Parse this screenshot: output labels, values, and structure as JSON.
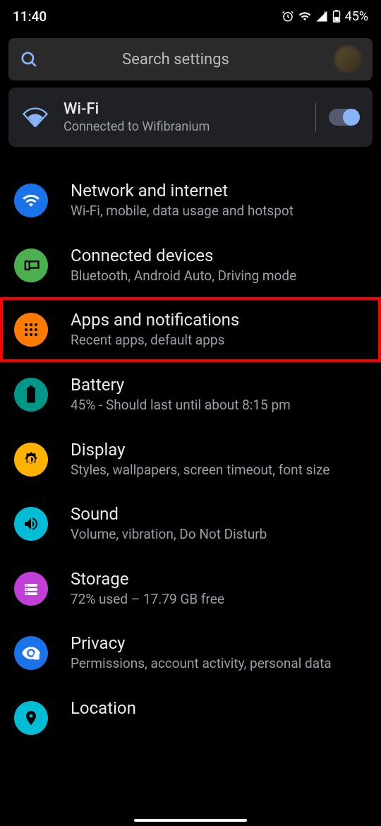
{
  "statusBar": {
    "time": "11:40",
    "batteryPercent": "45%"
  },
  "search": {
    "placeholder": "Search settings"
  },
  "wifiCard": {
    "title": "Wi-Fi",
    "subtitle": "Connected to Wifibranium",
    "toggled": true
  },
  "items": [
    {
      "title": "Network and internet",
      "subtitle": "Wi-Fi, mobile, data usage and hotspot",
      "iconBg": "#1a73e8",
      "highlighted": false
    },
    {
      "title": "Connected devices",
      "subtitle": "Bluetooth, Android Auto, Driving mode",
      "iconBg": "#4caf50",
      "highlighted": false
    },
    {
      "title": "Apps and notifications",
      "subtitle": "Recent apps, default apps",
      "iconBg": "#ff7b00",
      "highlighted": true
    },
    {
      "title": "Battery",
      "subtitle": "45% - Should last until about 8:15 pm",
      "iconBg": "#009688",
      "highlighted": false
    },
    {
      "title": "Display",
      "subtitle": "Styles, wallpapers, screen timeout, font size",
      "iconBg": "#ffb300",
      "highlighted": false
    },
    {
      "title": "Sound",
      "subtitle": "Volume, vibration, Do Not Disturb",
      "iconBg": "#00bcd4",
      "highlighted": false
    },
    {
      "title": "Storage",
      "subtitle": "72% used – 17.79 GB free",
      "iconBg": "#c03fd6",
      "highlighted": false
    },
    {
      "title": "Privacy",
      "subtitle": "Permissions, account activity, personal data",
      "iconBg": "#1a73e8",
      "highlighted": false
    },
    {
      "title": "Location",
      "subtitle": "",
      "iconBg": "#00bcd4",
      "highlighted": false
    }
  ]
}
